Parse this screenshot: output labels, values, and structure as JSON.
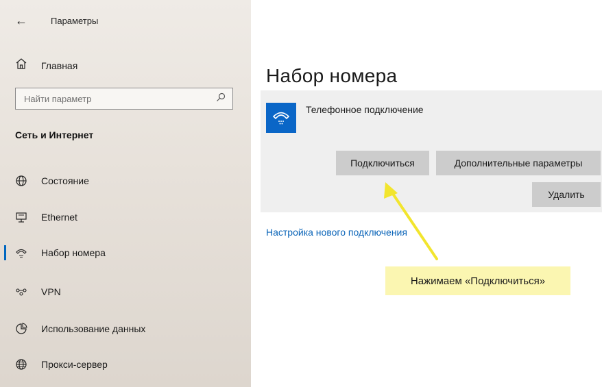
{
  "window": {
    "title": "Параметры"
  },
  "sidebar": {
    "home_label": "Главная",
    "search_placeholder": "Найти параметр",
    "section_title": "Сеть и Интернет",
    "items": [
      {
        "label": "Состояние",
        "icon": "globe-status-icon"
      },
      {
        "label": "Ethernet",
        "icon": "ethernet-icon"
      },
      {
        "label": "Набор номера",
        "icon": "dialup-icon",
        "active": true
      },
      {
        "label": "VPN",
        "icon": "vpn-icon"
      },
      {
        "label": "Использование данных",
        "icon": "data-usage-icon"
      },
      {
        "label": "Прокси-сервер",
        "icon": "globe-icon"
      }
    ]
  },
  "main": {
    "title": "Набор номера",
    "connection": {
      "name": "Телефонное подключение",
      "connect_label": "Подключиться",
      "advanced_label": "Дополнительные параметры",
      "delete_label": "Удалить"
    },
    "new_connection_link": "Настройка нового подключения"
  },
  "annotation": {
    "text": "Нажимаем «Подключиться»"
  },
  "colors": {
    "accent": "#0067c0",
    "link": "#0a64b8",
    "annotation_bg": "#fbf6b1",
    "arrow": "#f2e52e"
  }
}
